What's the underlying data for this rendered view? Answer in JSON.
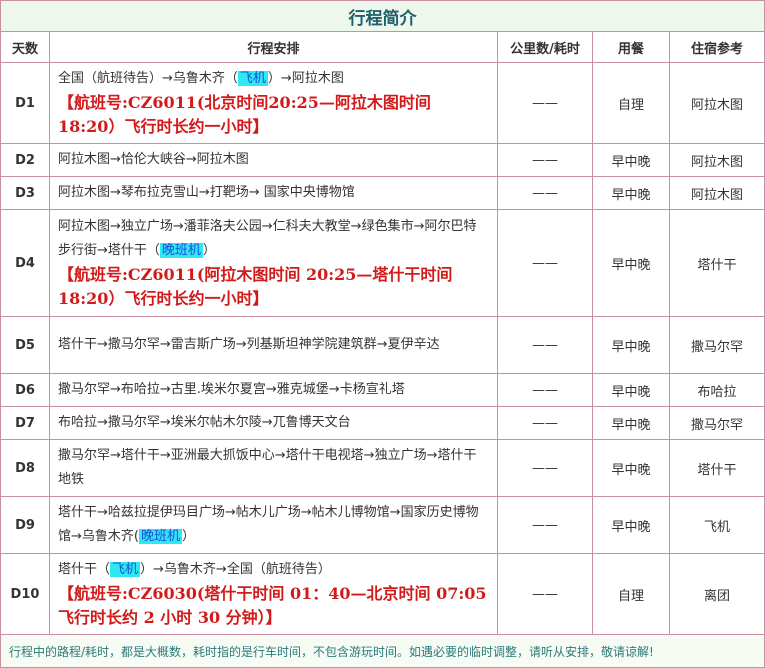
{
  "title": "行程简介",
  "headers": {
    "day": "天数",
    "plan": "行程安排",
    "distance": "公里数/耗时",
    "meals": "用餐",
    "hotel": "住宿参考"
  },
  "days": [
    {
      "day": "D1",
      "pre": "全国（航班待告）→乌鲁木齐（",
      "hl": "飞机",
      "post": "）→阿拉木图",
      "flight": "【航班号:CZ6011(北京时间20:25—阿拉木图时间 18:20）飞行时长约一小时】",
      "distance": "——",
      "meals": "自理",
      "hotel": "阿拉木图"
    },
    {
      "day": "D2",
      "pre": "阿拉木图→恰伦大峡谷→阿拉木图",
      "hl": "",
      "post": "",
      "flight": "",
      "distance": "——",
      "meals": "早中晚",
      "hotel": "阿拉木图"
    },
    {
      "day": "D3",
      "pre": "阿拉木图→琴布拉克雪山→打靶场→ 国家中央博物馆",
      "hl": "",
      "post": "",
      "flight": "",
      "distance": "——",
      "meals": "早中晚",
      "hotel": "阿拉木图"
    },
    {
      "day": "D4",
      "pre": "阿拉木图→独立广场→潘菲洛夫公园→仁科夫大教堂→绿色集市→阿尔巴特步行街→塔什干（",
      "hl": "晚班机",
      "post": "）",
      "flight": "【航班号:CZ6011(阿拉木图时间 20:25—塔什干时间 18:20）飞行时长约一小时】",
      "distance": "——",
      "meals": "早中晚",
      "hotel": "塔什干"
    },
    {
      "day": "D5",
      "pre": "塔什干→撒马尔罕→雷吉斯广场→列基斯坦神学院建筑群→夏伊辛达",
      "hl": "",
      "post": "",
      "flight": "",
      "distance": "——",
      "meals": "早中晚",
      "hotel": "撒马尔罕"
    },
    {
      "day": "D6",
      "pre": "撒马尔罕→布哈拉→古里.埃米尔夏宫→雅克城堡→卡杨宣礼塔",
      "hl": "",
      "post": "",
      "flight": "",
      "distance": "——",
      "meals": "早中晚",
      "hotel": "布哈拉"
    },
    {
      "day": "D7",
      "pre": "布哈拉→撒马尔罕→埃米尔帖木尔陵→兀鲁博天文台",
      "hl": "",
      "post": "",
      "flight": "",
      "distance": "——",
      "meals": "早中晚",
      "hotel": "撒马尔罕"
    },
    {
      "day": "D8",
      "pre": "撒马尔罕→塔什干→亚洲最大抓饭中心→塔什干电视塔→独立广场→塔什干地铁",
      "hl": "",
      "post": "",
      "flight": "",
      "distance": "——",
      "meals": "早中晚",
      "hotel": "塔什干"
    },
    {
      "day": "D9",
      "pre": "塔什干→哈兹拉提伊玛目广场→帖木儿广场→帖木儿博物馆→国家历史博物馆→乌鲁木齐(",
      "hl": "晚班机",
      "post": "）",
      "flight": "",
      "distance": "——",
      "meals": "早中晚",
      "hotel": "飞机"
    },
    {
      "day": "D10",
      "pre": "塔什干（",
      "hl": "飞机",
      "post": "）→乌鲁木齐→全国（航班待告）",
      "flight": "【航班号:CZ6030(塔什干时间 01：40—北京时间 07:05 飞行时长约 2 小时 30 分钟）】",
      "distance": "——",
      "meals": "自理",
      "hotel": "离团"
    }
  ],
  "note": "行程中的路程/耗时，都是大概数，耗时指的是行车时间，不包含游玩时间。如遇必要的临时调整，请听从安排，敬请谅解!"
}
